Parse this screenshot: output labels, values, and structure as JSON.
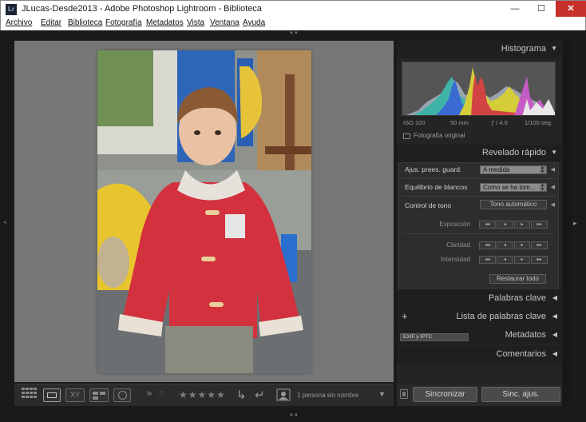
{
  "window": {
    "title": "JLucas-Desde2013 - Adobe Photoshop Lightroom - Biblioteca",
    "app_icon_text": "Lr",
    "minimize": "—",
    "maximize": "☐",
    "close": "✕"
  },
  "menu": [
    "Archivo",
    "Editar",
    "Biblioteca",
    "Fotografía",
    "Metadatos",
    "Vista",
    "Ventana",
    "Ayuda"
  ],
  "histogram": {
    "title": "Histograma",
    "iso": "ISO 100",
    "focal": "50 mm",
    "aperture": "ƒ / 4.0",
    "shutter": "1/100 seg.",
    "original_label": "Fotografía original"
  },
  "quick_develop": {
    "title": "Revelado rápido",
    "preset_label": "Ajus. prees. guard.",
    "preset_value": "A medida",
    "wb_label": "Equilibrio de blancos",
    "wb_value": "Como se ha tom...",
    "tone_label": "Control de tono",
    "tone_auto": "Tono automático",
    "exposure_label": "Exposición",
    "clarity_label": "Claridad",
    "vibrance_label": "Intensidad",
    "reset_label": "Restaurar todo",
    "step_big_down": "◂◂",
    "step_down": "◂",
    "step_up": "▸",
    "step_big_up": "▸▸"
  },
  "panels": {
    "keywords": "Palabras clave",
    "keyword_list": "Lista de palabras clave",
    "keyword_add": "+",
    "metadata": "Metadatos",
    "metadata_preset": "EXIF y IPTC",
    "comments": "Comentarios"
  },
  "sync": {
    "sync_label": "Sincronizar",
    "sync_settings_label": "Sinc. ajus."
  },
  "toolbar": {
    "stars": "★★★★★",
    "face_label": "1 persona sin nombre",
    "compare_label": "XY"
  },
  "icons": {
    "expand_left": "◂",
    "expand_right": "▸",
    "panel_collapse": "▼",
    "panel_expand": "◀"
  }
}
